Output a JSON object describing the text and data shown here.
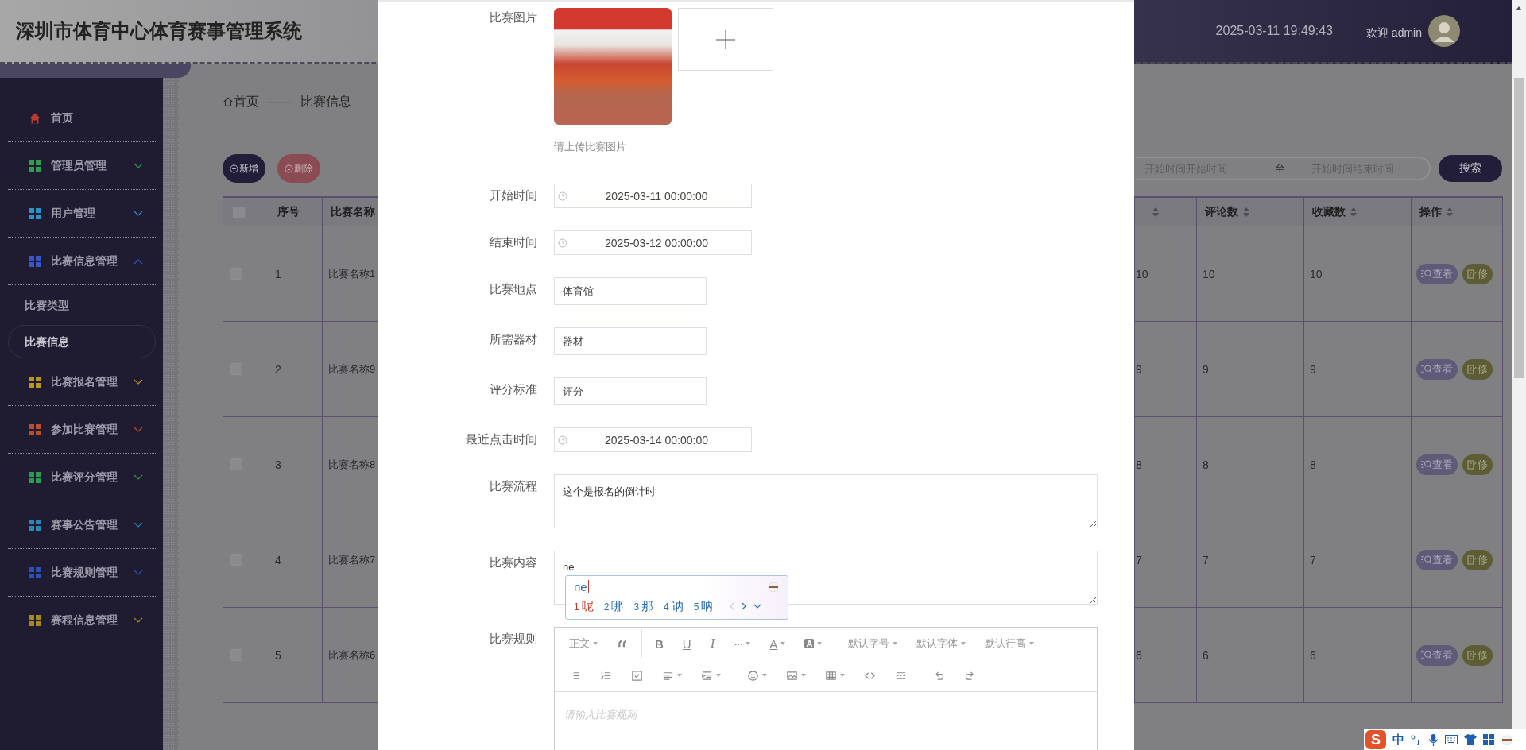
{
  "header": {
    "title": "深圳市体育中心体育赛事管理系统",
    "datetime": "2025-03-11 19:49:43",
    "welcome": "欢迎 admin"
  },
  "sidebar": {
    "items": [
      {
        "label": "首页",
        "kind": "link",
        "color": "#c0392b"
      },
      {
        "label": "管理员管理",
        "kind": "group",
        "expanded": false,
        "color": "#2e9e4f"
      },
      {
        "label": "用户管理",
        "kind": "group",
        "expanded": false,
        "color": "#2a93c9"
      },
      {
        "label": "比赛信息管理",
        "kind": "group",
        "expanded": true,
        "color": "#3557c9",
        "children": [
          {
            "label": "比赛类型",
            "selected": false
          },
          {
            "label": "比赛信息",
            "selected": true
          }
        ]
      },
      {
        "label": "比赛报名管理",
        "kind": "group",
        "expanded": false,
        "color": "#b8961e"
      },
      {
        "label": "参加比赛管理",
        "kind": "group",
        "expanded": false,
        "color": "#b8502c"
      },
      {
        "label": "比赛评分管理",
        "kind": "group",
        "expanded": false,
        "color": "#279c52"
      },
      {
        "label": "赛事公告管理",
        "kind": "group",
        "expanded": false,
        "color": "#2a86b5"
      },
      {
        "label": "比赛规则管理",
        "kind": "group",
        "expanded": false,
        "color": "#2f4fb8"
      },
      {
        "label": "赛程信息管理",
        "kind": "group",
        "expanded": false,
        "color": "#a8891b"
      }
    ]
  },
  "breadcrumb": {
    "home": "首页",
    "separator": "——",
    "current": "比赛信息"
  },
  "actions": [
    {
      "label": "新增",
      "kind": "add"
    },
    {
      "label": "删除",
      "kind": "delete"
    }
  ],
  "search": {
    "start_placeholder": "开始时间开始时间",
    "separator": "至",
    "end_placeholder": "开始时间结束时间",
    "button": "搜索"
  },
  "table": {
    "select_all_checked": false,
    "columns": [
      {
        "label": "序号",
        "sortable": false
      },
      {
        "label": "比赛名称",
        "sortable": false
      },
      {
        "sortable": true
      },
      {
        "label": "评论数",
        "sortable": true
      },
      {
        "label": "收藏数",
        "sortable": true
      },
      {
        "label": "操作",
        "sortable": true
      }
    ],
    "rows": [
      {
        "checked": false,
        "index": "1",
        "name": "比赛名称1",
        "column_4": "10",
        "comments": "10",
        "favorites": "10",
        "buttons": [
          {
            "kind": "view",
            "label": "查看"
          },
          {
            "kind": "edit",
            "label": "修"
          }
        ]
      },
      {
        "checked": false,
        "index": "2",
        "name": "比赛名称9",
        "column_4": "9",
        "comments": "9",
        "favorites": "9",
        "buttons": [
          {
            "kind": "view",
            "label": "查看"
          },
          {
            "kind": "edit",
            "label": "修"
          }
        ]
      },
      {
        "checked": false,
        "index": "3",
        "name": "比赛名称8",
        "column_4": "8",
        "comments": "8",
        "favorites": "8",
        "buttons": [
          {
            "kind": "view",
            "label": "查看"
          },
          {
            "kind": "edit",
            "label": "修"
          }
        ]
      },
      {
        "checked": false,
        "index": "4",
        "name": "比赛名称7",
        "column_4": "7",
        "comments": "7",
        "favorites": "7",
        "buttons": [
          {
            "kind": "view",
            "label": "查看"
          },
          {
            "kind": "edit",
            "label": "修"
          }
        ]
      },
      {
        "checked": false,
        "index": "5",
        "name": "比赛名称6",
        "column_4": "6",
        "comments": "6",
        "favorites": "6",
        "buttons": [
          {
            "kind": "view",
            "label": "查看"
          },
          {
            "kind": "edit",
            "label": "修"
          }
        ]
      }
    ]
  },
  "form": {
    "fields": [
      {
        "label": "比赛图片",
        "kind": "image",
        "hint": "请上传比赛图片"
      },
      {
        "label": "开始时间",
        "kind": "datetime",
        "value": "2025-03-11 00:00:00"
      },
      {
        "label": "结束时间",
        "kind": "datetime",
        "value": "2025-03-12 00:00:00"
      },
      {
        "label": "比赛地点",
        "kind": "text",
        "value": "体育馆"
      },
      {
        "label": "所需器材",
        "kind": "text",
        "value": "器材"
      },
      {
        "label": "评分标准",
        "kind": "text",
        "value": "评分"
      },
      {
        "label": "最近点击时间",
        "kind": "datetime",
        "value": "2025-03-14 00:00:00"
      },
      {
        "label": "比赛流程",
        "kind": "textarea",
        "value": "这个是报名的倒计时"
      },
      {
        "label": "比赛内容",
        "kind": "textarea",
        "value": "ne",
        "ime": {
          "composition": "ne",
          "candidates": [
            {
              "number": "1",
              "text": "呢",
              "selected": true
            },
            {
              "number": "2",
              "text": "哪",
              "selected": false
            },
            {
              "number": "3",
              "text": "那",
              "selected": false
            },
            {
              "number": "4",
              "text": "讷",
              "selected": false
            },
            {
              "number": "5",
              "text": "呐",
              "selected": false
            }
          ]
        }
      },
      {
        "label": "比赛规则",
        "kind": "editor",
        "placeholder": "请输入比赛规则",
        "toolbar": [
          [
            {
              "kind": "select",
              "label": "正文"
            },
            {
              "kind": "quote"
            },
            {
              "kind": "sep"
            },
            {
              "kind": "bold",
              "label": "B"
            },
            {
              "kind": "underline",
              "label": "U"
            },
            {
              "kind": "italic",
              "label": "I"
            },
            {
              "kind": "more",
              "label": "···",
              "dropdown": true
            },
            {
              "kind": "color",
              "label": "A",
              "dropdown": true
            },
            {
              "kind": "background",
              "label": "A",
              "dropdown": true
            },
            {
              "kind": "sep"
            },
            {
              "kind": "select",
              "label": "默认字号"
            },
            {
              "kind": "select",
              "label": "默认字体"
            },
            {
              "kind": "select",
              "label": "默认行高"
            }
          ],
          [
            {
              "kind": "bullet-list"
            },
            {
              "kind": "numbered-list"
            },
            {
              "kind": "checklist"
            },
            {
              "kind": "align-left",
              "dropdown": true
            },
            {
              "kind": "indent",
              "dropdown": true
            },
            {
              "kind": "sep"
            },
            {
              "kind": "smiley",
              "dropdown": true
            },
            {
              "kind": "image",
              "dropdown": true
            },
            {
              "kind": "table",
              "dropdown": true
            },
            {
              "kind": "code"
            },
            {
              "kind": "divider"
            },
            {
              "kind": "sep"
            },
            {
              "kind": "undo"
            },
            {
              "kind": "redo"
            }
          ]
        ]
      }
    ]
  },
  "ime_bar": {
    "logo": "S",
    "mode": "中"
  }
}
